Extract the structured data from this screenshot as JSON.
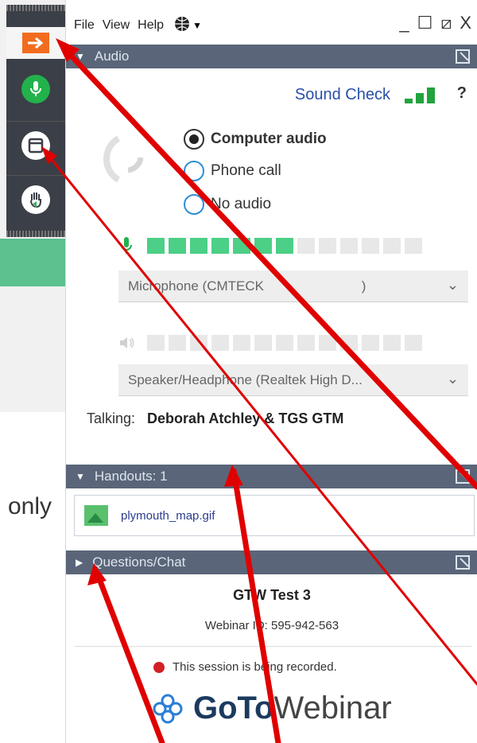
{
  "background": {
    "partial_text": "only"
  },
  "menubar": {
    "file": "File",
    "view": "View",
    "help": "Help",
    "window_controls": [
      "_",
      "☐",
      "⧄",
      "X"
    ]
  },
  "audio": {
    "header": "Audio",
    "sound_check": "Sound Check",
    "help_symbol": "?",
    "options": {
      "computer": "Computer audio",
      "phone": "Phone call",
      "none": "No audio"
    },
    "selected_option": "Computer audio",
    "mic_level_segments_on": 7,
    "mic_level_segments_total": 13,
    "microphone_device": "Microphone (CMTECK                          )",
    "speaker_device": "Speaker/Headphone (Realtek High D...",
    "talking_label": "Talking:",
    "talking_names": "Deborah Atchley & TGS GTM"
  },
  "handouts": {
    "header": "Handouts: 1",
    "file_name": "plymouth_map.gif"
  },
  "questions": {
    "header": "Questions/Chat"
  },
  "webinar": {
    "name": "GTW Test 3",
    "id_text": "Webinar ID: 595-942-563",
    "recording_text": "This session is being recorded.",
    "logo_bold": "GoTo",
    "logo_light": "Webinar"
  },
  "colors": {
    "header_bg": "#5a6579",
    "link_blue": "#2a4fa8",
    "meter_green": "#4ccf86",
    "mic_button_green": "#22b24c",
    "exit_orange": "#f26c1e",
    "annotation_red": "#e00000"
  },
  "icons": {
    "exit": "arrow-right-icon",
    "mic": "microphone-icon",
    "handout": "window-icon",
    "raise_hand": "raise-hand-icon",
    "language": "globe-icon",
    "speaker": "speaker-icon",
    "file": "image-file-icon",
    "recording": "record-dot-icon"
  }
}
